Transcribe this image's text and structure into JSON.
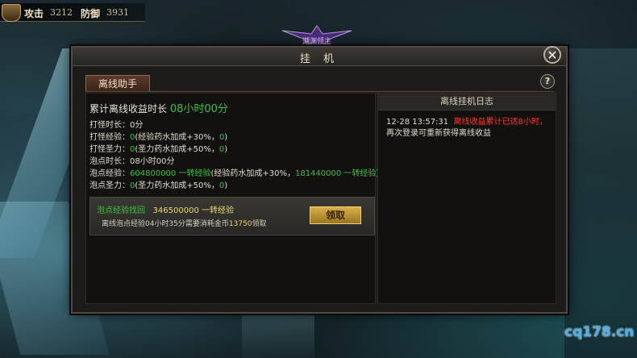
{
  "hud": {
    "attack_label": "攻击",
    "attack_value": "3212",
    "defense_label": "防御",
    "defense_value": "3931",
    "emblem_text": "潮渊领主"
  },
  "dialog": {
    "title": "挂 机",
    "close_symbol": "✕",
    "help_symbol": "?",
    "tab_label": "离线助手"
  },
  "summary": {
    "total_label": "累计离线收益时长",
    "total_value": "08小时00分",
    "rows": [
      {
        "label": "打怪时长：",
        "value": "0分"
      },
      {
        "label": "打怪经验：",
        "value": "0",
        "suffix": "(经验药水加成+30%，",
        "extra": "0",
        "end": ")"
      },
      {
        "label": "打怪圣力：",
        "value": "0",
        "suffix": "(圣力药水加成+50%，",
        "extra": "0",
        "end": ")"
      },
      {
        "label": "泡点时长：",
        "value": "08小时00分"
      },
      {
        "label": "泡点经验：",
        "value": "604800000 一转经验",
        "suffix": "(经验药水加成+30%，",
        "extra": "181440000 一转经验",
        "end": ")"
      },
      {
        "label": "泡点圣力：",
        "value": "0",
        "suffix": "(圣力药水加成+50%，",
        "extra": "0",
        "end": ")"
      }
    ]
  },
  "reclaim": {
    "title": "泡点经验找回",
    "amount": "346500000 一转经验",
    "desc_prefix": "离线泡点经验04小时35分需要消耗金币",
    "desc_cost": "13750",
    "desc_suffix": "领取",
    "button_label": "领取"
  },
  "log": {
    "header": "离线挂机日志",
    "entries": [
      {
        "time": "12-28  13:57:31",
        "highlight": "离线收益累计已达8小时，",
        "text": "再次登录可重新获得离线收益"
      }
    ]
  },
  "watermark": "cq178.cn"
}
